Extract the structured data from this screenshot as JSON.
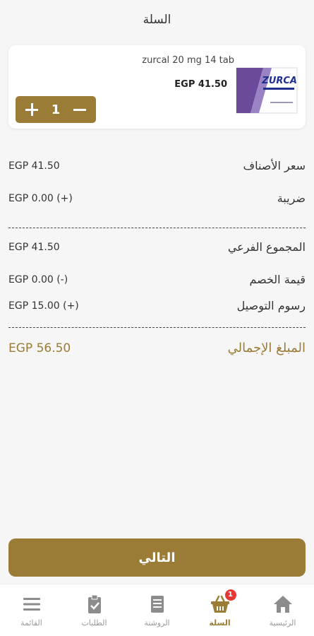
{
  "header": {
    "title": "السلة"
  },
  "cart_item": {
    "name": "zurcal 20 mg 14 tab",
    "price": "EGP 41.50",
    "quantity": "1",
    "image_text": "ZURCA"
  },
  "summary": {
    "items_price": {
      "label": "سعر الأصناف",
      "value": "EGP 41.50"
    },
    "tax": {
      "label": "ضريبة",
      "value": "EGP 0.00 (+)"
    },
    "subtotal": {
      "label": "المجموع الفرعي",
      "value": "EGP 41.50"
    },
    "discount": {
      "label": "قيمة الخصم",
      "value": "EGP 0.00 (-)"
    },
    "delivery": {
      "label": "رسوم التوصيل",
      "value": "EGP 15.00 (+)"
    },
    "total": {
      "label": "المبلغ الإجمالي",
      "value": "EGP 56.50"
    }
  },
  "next_button": {
    "label": "التالي"
  },
  "bottom_nav": {
    "menu": {
      "label": "القائمة",
      "icon": "menu-icon"
    },
    "orders": {
      "label": "الطلبات",
      "icon": "clipboard-check-icon"
    },
    "prescription": {
      "label": "الروشتة",
      "icon": "prescription-icon"
    },
    "cart": {
      "label": "السلة",
      "icon": "basket-icon",
      "badge": "1"
    },
    "home": {
      "label": "الرئيسية",
      "icon": "home-icon"
    }
  },
  "colors": {
    "accent": "#9b7c36",
    "badge": "#e53935",
    "background": "#f6f6f6"
  }
}
